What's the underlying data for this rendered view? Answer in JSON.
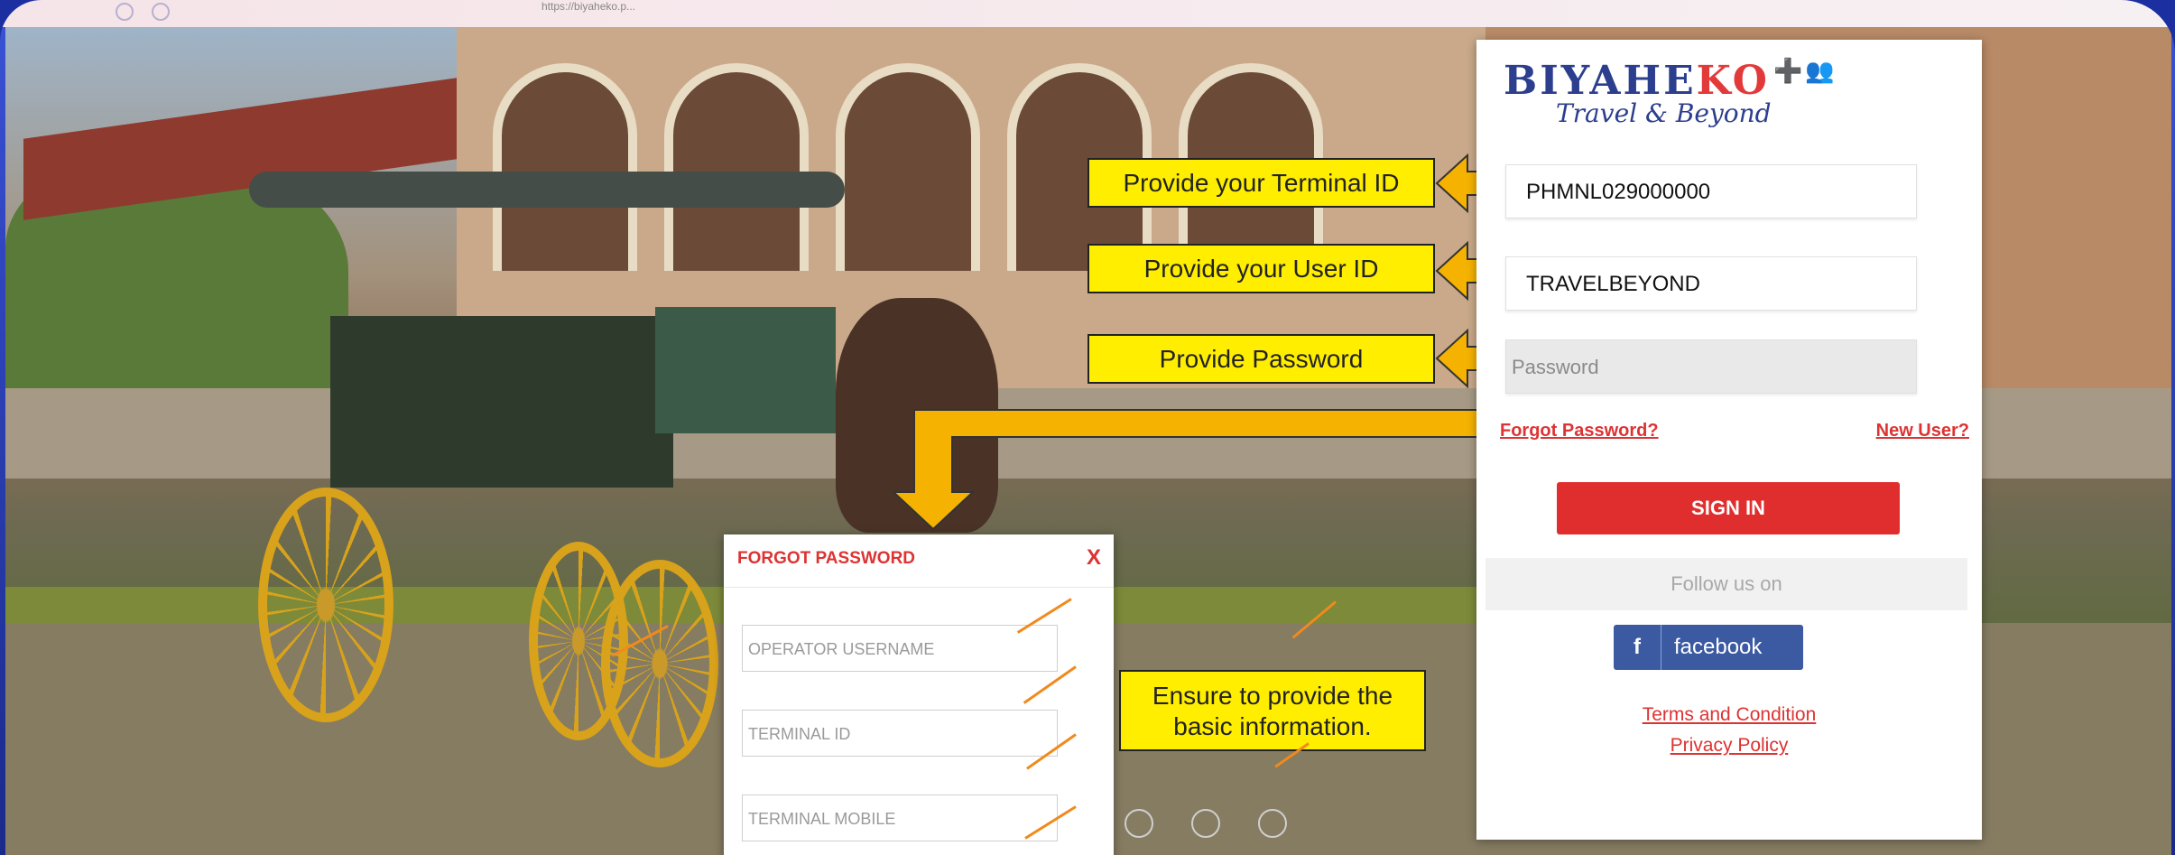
{
  "browser": {
    "url": "https://biyaheko.p..."
  },
  "login": {
    "logo_text_a": "BIYAHE",
    "logo_text_b": "KO",
    "logo_tagline": "Travel & Beyond",
    "terminal_id_value": "PHMNL029000000",
    "user_id_value": "TRAVELBEYOND",
    "password_placeholder": "Password",
    "forgot_password": "Forgot Password?",
    "new_user": "New User?",
    "sign_in": "SIGN IN",
    "follow_us": "Follow us on",
    "facebook_f": "f",
    "facebook": "facebook",
    "terms": "Terms and Condition",
    "privacy": "Privacy Policy"
  },
  "callouts": {
    "terminal": "Provide your Terminal ID",
    "user": "Provide your User ID",
    "password": "Provide Password",
    "basic_info_1": "Ensure to provide the",
    "basic_info_2": "basic information."
  },
  "forgot_dialog": {
    "title": "FORGOT PASSWORD",
    "close": "X",
    "operator_username": "OPERATOR USERNAME",
    "terminal_id": "TERMINAL ID",
    "terminal_mobile": "TERMINAL MOBILE"
  },
  "colors": {
    "accent_red": "#e02e2e",
    "callout_yellow": "#ffee00",
    "arrow_orange": "#f6b200",
    "brand_blue": "#2c3e8e",
    "facebook_blue": "#3b5aa2"
  }
}
